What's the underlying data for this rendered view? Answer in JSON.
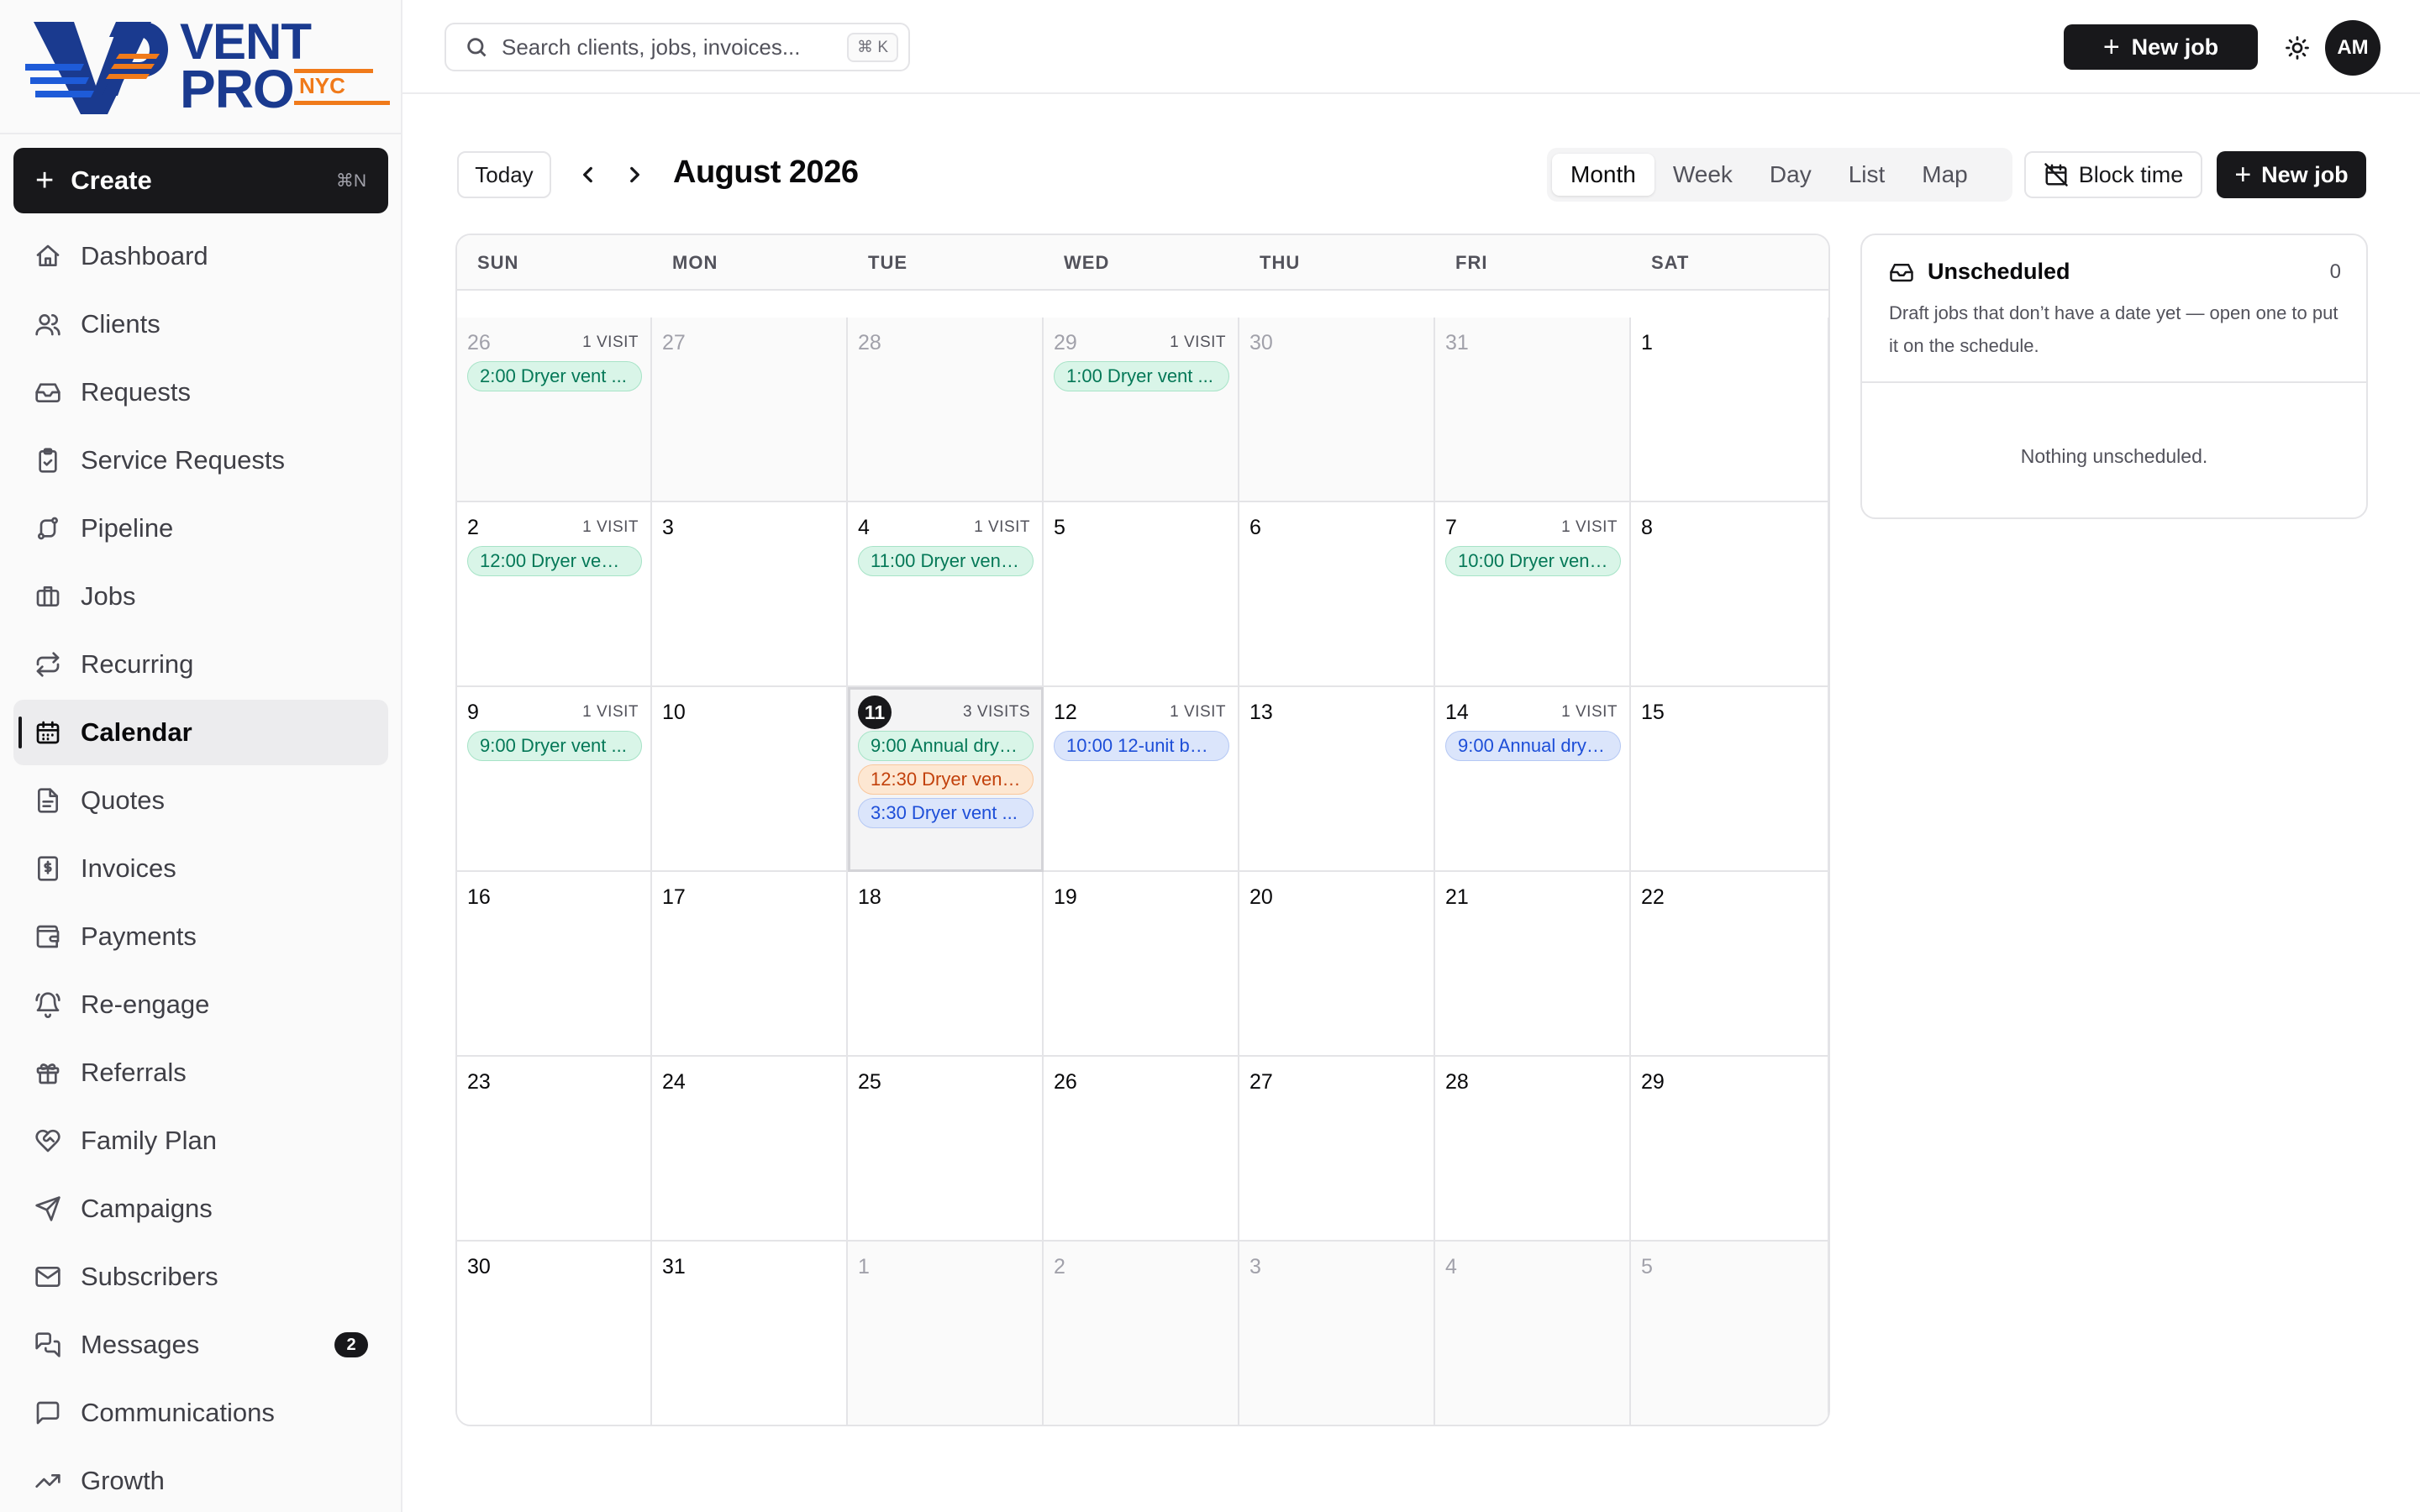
{
  "brand": {
    "line1": "VENT",
    "line2": "PRO",
    "tag": "NYC",
    "colors": {
      "navy": "#1a3a8f",
      "orange": "#f07a1a"
    }
  },
  "sidebar": {
    "create": {
      "label": "Create",
      "shortcut": "⌘N"
    },
    "items": [
      {
        "label": "Dashboard",
        "icon": "home-icon"
      },
      {
        "label": "Clients",
        "icon": "users-icon"
      },
      {
        "label": "Requests",
        "icon": "inbox-icon"
      },
      {
        "label": "Service Requests",
        "icon": "clipboard-check-icon"
      },
      {
        "label": "Pipeline",
        "icon": "route-icon"
      },
      {
        "label": "Jobs",
        "icon": "briefcase-icon"
      },
      {
        "label": "Recurring",
        "icon": "repeat-icon"
      },
      {
        "label": "Calendar",
        "icon": "calendar-icon"
      },
      {
        "label": "Quotes",
        "icon": "file-text-icon"
      },
      {
        "label": "Invoices",
        "icon": "receipt-icon"
      },
      {
        "label": "Payments",
        "icon": "wallet-icon"
      },
      {
        "label": "Re-engage",
        "icon": "bell-ring-icon"
      },
      {
        "label": "Referrals",
        "icon": "gift-icon"
      },
      {
        "label": "Family Plan",
        "icon": "heart-handshake-icon"
      },
      {
        "label": "Campaigns",
        "icon": "send-icon"
      },
      {
        "label": "Subscribers",
        "icon": "mail-icon"
      },
      {
        "label": "Messages",
        "icon": "messages-icon",
        "badge": "2"
      },
      {
        "label": "Communications",
        "icon": "message-square-icon"
      },
      {
        "label": "Growth",
        "icon": "trending-up-icon"
      }
    ],
    "active": "Calendar"
  },
  "topbar": {
    "search_placeholder": "Search clients, jobs, invoices...",
    "search_shortcut": "⌘ K",
    "new_job": "New job",
    "avatar": "AM"
  },
  "calendar": {
    "today_label": "Today",
    "title": "August 2026",
    "views": [
      "Month",
      "Week",
      "Day",
      "List",
      "Map"
    ],
    "active_view": "Month",
    "block_time": "Block time",
    "new_job": "New job",
    "weekdays": [
      "SUN",
      "MON",
      "TUE",
      "WED",
      "THU",
      "FRI",
      "SAT"
    ],
    "weeks": [
      [
        {
          "day": "26",
          "outside": true,
          "count": "1 VISIT",
          "events": [
            {
              "text": "2:00 Dryer vent ...",
              "color": "green"
            }
          ]
        },
        {
          "day": "27",
          "outside": true
        },
        {
          "day": "28",
          "outside": true
        },
        {
          "day": "29",
          "outside": true,
          "count": "1 VISIT",
          "events": [
            {
              "text": "1:00 Dryer vent ...",
              "color": "green"
            }
          ]
        },
        {
          "day": "30",
          "outside": true
        },
        {
          "day": "31",
          "outside": true
        },
        {
          "day": "1"
        }
      ],
      [
        {
          "day": "2",
          "count": "1 VISIT",
          "events": [
            {
              "text": "12:00 Dryer vent...",
              "color": "green"
            }
          ]
        },
        {
          "day": "3"
        },
        {
          "day": "4",
          "count": "1 VISIT",
          "events": [
            {
              "text": "11:00 Dryer vent...",
              "color": "green"
            }
          ]
        },
        {
          "day": "5"
        },
        {
          "day": "6"
        },
        {
          "day": "7",
          "count": "1 VISIT",
          "events": [
            {
              "text": "10:00 Dryer vent...",
              "color": "green"
            }
          ]
        },
        {
          "day": "8"
        }
      ],
      [
        {
          "day": "9",
          "count": "1 VISIT",
          "events": [
            {
              "text": "9:00 Dryer vent ...",
              "color": "green"
            }
          ]
        },
        {
          "day": "10"
        },
        {
          "day": "11",
          "today": true,
          "count": "3 VISITS",
          "events": [
            {
              "text": "9:00 Annual drye...",
              "color": "green"
            },
            {
              "text": "12:30 Dryer vent...",
              "color": "orange"
            },
            {
              "text": "3:30 Dryer vent ...",
              "color": "blue"
            }
          ]
        },
        {
          "day": "12",
          "count": "1 VISIT",
          "events": [
            {
              "text": "10:00 12-unit bui...",
              "color": "blue"
            }
          ]
        },
        {
          "day": "13"
        },
        {
          "day": "14",
          "count": "1 VISIT",
          "events": [
            {
              "text": "9:00 Annual drye...",
              "color": "blue"
            }
          ]
        },
        {
          "day": "15"
        }
      ],
      [
        {
          "day": "16"
        },
        {
          "day": "17"
        },
        {
          "day": "18"
        },
        {
          "day": "19"
        },
        {
          "day": "20"
        },
        {
          "day": "21"
        },
        {
          "day": "22"
        }
      ],
      [
        {
          "day": "23"
        },
        {
          "day": "24"
        },
        {
          "day": "25"
        },
        {
          "day": "26"
        },
        {
          "day": "27"
        },
        {
          "day": "28"
        },
        {
          "day": "29"
        }
      ],
      [
        {
          "day": "30"
        },
        {
          "day": "31"
        },
        {
          "day": "1",
          "outside": true
        },
        {
          "day": "2",
          "outside": true
        },
        {
          "day": "3",
          "outside": true
        },
        {
          "day": "4",
          "outside": true
        },
        {
          "day": "5",
          "outside": true
        }
      ]
    ]
  },
  "unscheduled": {
    "title": "Unscheduled",
    "count": "0",
    "description": "Draft jobs that don’t have a date yet — open one to put it on the schedule.",
    "empty": "Nothing unscheduled."
  }
}
